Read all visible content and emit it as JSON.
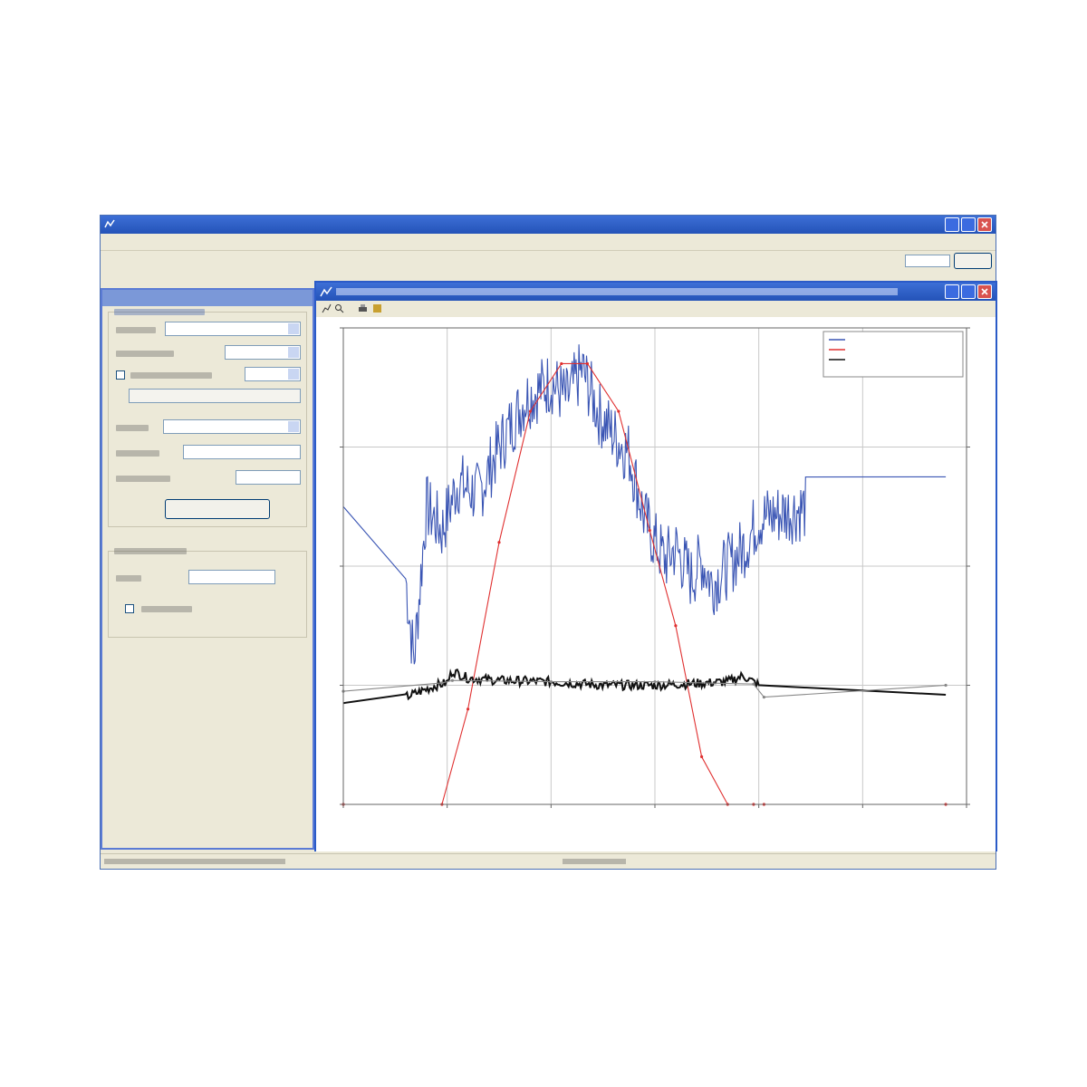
{
  "app": {
    "title": "",
    "menu": [
      "",
      "",
      "",
      "",
      ""
    ],
    "close_icon": "close-icon",
    "colors": {
      "titlebar": "#2453b8",
      "panel_title": "#7b98d8",
      "window_face": "#ece9d8"
    }
  },
  "chart_window": {
    "title": "",
    "icons": [
      "chart-icon",
      "zoom-icon",
      "print-icon",
      "export-icon"
    ]
  },
  "chart_data": {
    "type": "line",
    "title": "",
    "xlabel": "",
    "ylabel": "",
    "x_tick_count": 7,
    "ylim": [
      0,
      400
    ],
    "y2lim": [
      0,
      400
    ],
    "grid": true,
    "legend_position": "top-right",
    "series": [
      {
        "color": "#3a55b4",
        "axis": "left",
        "x": [
          0,
          0.6,
          0.68,
          0.8,
          0.95,
          1.1,
          1.3,
          1.5,
          1.75,
          2.0,
          2.15,
          2.3,
          2.45,
          2.6,
          2.75,
          2.9,
          3.0,
          3.1,
          3.2,
          3.35,
          3.45,
          3.55,
          3.7,
          3.85,
          4.0,
          5.8
        ],
        "y": [
          250,
          190,
          120,
          250,
          230,
          270,
          260,
          300,
          340,
          355,
          340,
          365,
          330,
          310,
          295,
          240,
          220,
          205,
          215,
          190,
          205,
          185,
          200,
          215,
          240,
          275
        ],
        "noisy_range": [
          0.6,
          4.45
        ]
      },
      {
        "color": "#e03030",
        "axis": "left",
        "x": [
          0,
          0.95,
          1.2,
          1.5,
          1.8,
          2.1,
          2.35,
          2.65,
          2.95,
          3.2,
          3.45,
          3.7,
          3.95,
          4.05,
          5.8
        ],
        "y": [
          0,
          0,
          80,
          220,
          330,
          370,
          370,
          330,
          230,
          150,
          40,
          0,
          0,
          0,
          0
        ]
      },
      {
        "color": "#111111",
        "axis": "left",
        "x": [
          0,
          0.6,
          0.9,
          1.0,
          1.05,
          1.2,
          1.5,
          2.0,
          2.5,
          3.0,
          3.5,
          3.7,
          3.85,
          4.0,
          4.05,
          5.8
        ],
        "y": [
          85,
          90,
          100,
          102,
          112,
          106,
          104,
          103,
          100,
          100,
          102,
          103,
          108,
          100,
          80,
          92
        ],
        "noisy_range": [
          0.6,
          4.0
        ]
      },
      {
        "color": "#888888",
        "axis": "left",
        "x": [
          0,
          0.95,
          1.05,
          2.0,
          3.0,
          3.95,
          4.05,
          5.8
        ],
        "y": [
          95,
          102,
          104,
          103,
          103,
          101,
          90,
          100
        ]
      }
    ]
  }
}
